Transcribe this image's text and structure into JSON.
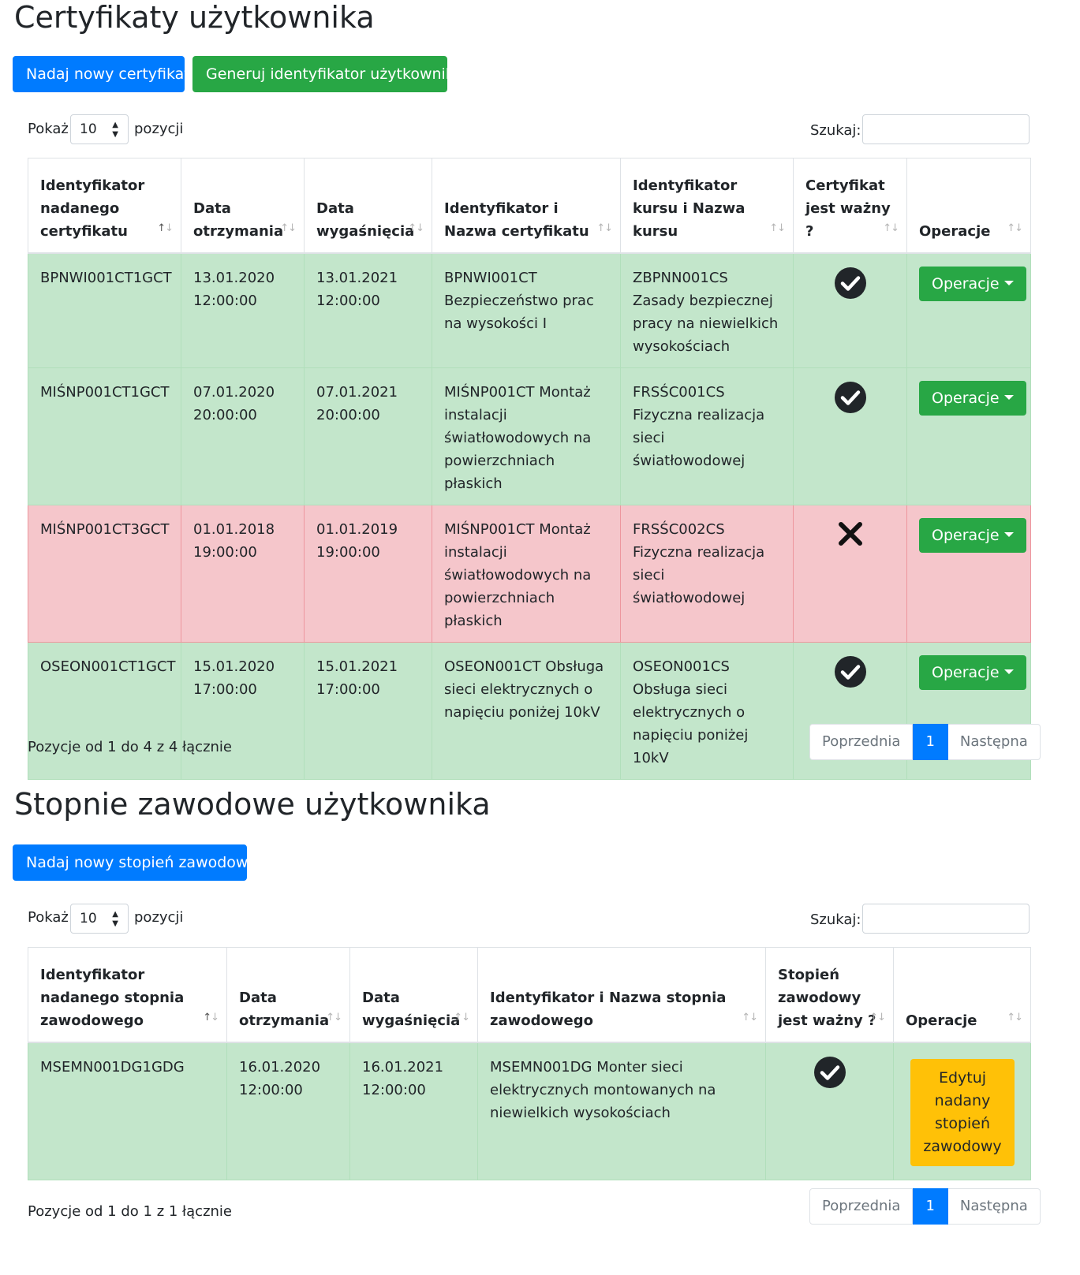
{
  "certificates": {
    "title": "Certyfikaty użytkownika",
    "add_button": "Nadaj nowy certyfikat",
    "generate_button": "Generuj identyfikator użytkownika",
    "show_label": "Pokaż",
    "page_size": "10",
    "entries_label": "pozycji",
    "search_label": "Szukaj:",
    "search_value": "",
    "columns": [
      "Identyfikator nadanego certyfikatu",
      "Data otrzymania",
      "Data wygaśnięcia",
      "Identyfikator i Nazwa certyfikatu",
      "Identyfikator kursu i Nazwa kursu",
      "Certyfikat jest ważny ?",
      "Operacje"
    ],
    "rows": [
      {
        "id": "BPNWI001CT1GCT",
        "received": "13.01.2020 12:00:00",
        "expires": "13.01.2021 12:00:00",
        "cert": "BPNWI001CT Bezpieczeństwo prac na wysokości I",
        "course": "ZBPNN001CS Zasady bezpiecznej pracy na niewielkich wysokościach",
        "valid": true,
        "op": "Operacje"
      },
      {
        "id": "MIŚNP001CT1GCT",
        "received": "07.01.2020 20:00:00",
        "expires": "07.01.2021 20:00:00",
        "cert": "MIŚNP001CT Montaż instalacji światłowodowych na powierzchniach płaskich",
        "course": "FRSŚC001CS Fizyczna realizacja sieci światłowodowej",
        "valid": true,
        "op": "Operacje"
      },
      {
        "id": "MIŚNP001CT3GCT",
        "received": "01.01.2018 19:00:00",
        "expires": "01.01.2019 19:00:00",
        "cert": "MIŚNP001CT Montaż instalacji światłowodowych na powierzchniach płaskich",
        "course": "FRSŚC002CS Fizyczna realizacja sieci światłowodowej",
        "valid": false,
        "op": "Operacje"
      },
      {
        "id": "OSEON001CT1GCT",
        "received": "15.01.2020 17:00:00",
        "expires": "15.01.2021 17:00:00",
        "cert": "OSEON001CT Obsługa sieci elektrycznych o napięciu poniżej 10kV",
        "course": "OSEON001CS Obsługa sieci elektrycznych o napięciu poniżej 10kV",
        "valid": true,
        "op": "Operacje"
      }
    ],
    "info": "Pozycje od 1 do 4 z 4 łącznie",
    "pagination": {
      "prev": "Poprzednia",
      "current": "1",
      "next": "Następna"
    }
  },
  "degrees": {
    "title": "Stopnie zawodowe użytkownika",
    "add_button": "Nadaj nowy stopień zawodowy",
    "show_label": "Pokaż",
    "page_size": "10",
    "entries_label": "pozycji",
    "search_label": "Szukaj:",
    "search_value": "",
    "columns": [
      "Identyfikator nadanego stopnia zawodowego",
      "Data otrzymania",
      "Data wygaśnięcia",
      "Identyfikator i Nazwa stopnia zawodowego",
      "Stopień zawodowy jest ważny ?",
      "Operacje"
    ],
    "rows": [
      {
        "id": "MSEMN001DG1GDG",
        "received": "16.01.2020 12:00:00",
        "expires": "16.01.2021 12:00:00",
        "degree": "MSEMN001DG Monter sieci elektrycznych montowanych na niewielkich wysokościach",
        "valid": true,
        "op": "Edytuj nadany stopień zawodowy"
      }
    ],
    "info": "Pozycje od 1 do 1 z 1 łącznie",
    "pagination": {
      "prev": "Poprzednia",
      "current": "1",
      "next": "Następna"
    }
  },
  "colors": {
    "primary": "#007bff",
    "success": "#28a745",
    "warning": "#ffc107",
    "row_valid": "#c3e6cb",
    "row_invalid": "#f5c6cb"
  },
  "icons": {
    "valid": "check-circle-icon",
    "invalid": "x-mark-icon",
    "sort": "sort-arrows-icon",
    "dropdown": "caret-down-icon"
  }
}
